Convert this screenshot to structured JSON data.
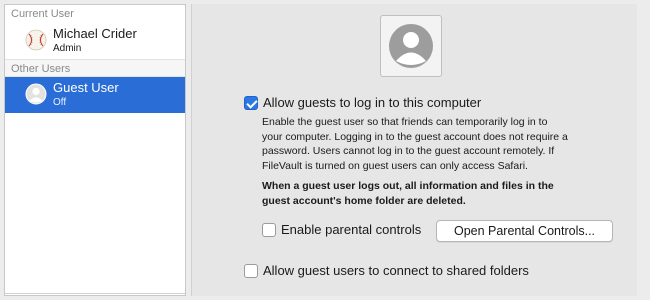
{
  "sidebar": {
    "current_user_header": "Current User",
    "current_user": {
      "name": "Michael Crider",
      "role": "Admin",
      "icon": "baseball-avatar-icon"
    },
    "other_users_header": "Other Users",
    "other_users": [
      {
        "name": "Guest User",
        "role": "Off",
        "icon": "person-silhouette-icon",
        "selected": true
      }
    ]
  },
  "main": {
    "avatar_icon": "person-silhouette-icon",
    "allow_guests": {
      "checked": true,
      "label": "Allow guests to log in to this computer"
    },
    "description_lines": [
      "Enable the guest user so that friends can temporarily log in to",
      "your computer. Logging in to the guest account does not require a",
      "password. Users cannot log in to the guest account remotely. If",
      "FileVault is turned on guest users can only access Safari."
    ],
    "warning_lines": [
      "When a guest user logs out, all information and files in the",
      "guest account's home folder are deleted."
    ],
    "parental_controls": {
      "checked": false,
      "label": "Enable parental controls",
      "button_label": "Open Parental Controls..."
    },
    "shared_folders": {
      "checked": false,
      "label": "Allow guest users to connect to shared folders"
    }
  },
  "colors": {
    "selection": "#2a6dd6",
    "checkbox_checked": "#2a78e4",
    "window_background": "#ececec"
  }
}
